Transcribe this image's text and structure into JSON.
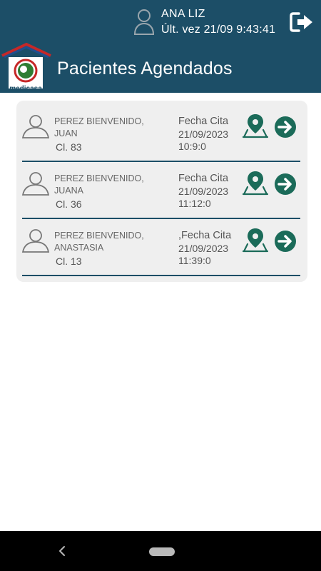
{
  "user": {
    "name": "ANA LIZ",
    "last_access": "Últ. vez 21/09 9:43:41"
  },
  "header": {
    "title": "Pacientes Agendados"
  },
  "logo": {
    "text": "medicasa"
  },
  "colors": {
    "header_bg": "#1c4e67",
    "accent": "#1b6b59",
    "card_bg": "#efefef"
  },
  "patients": [
    {
      "name_line1": "PEREZ BIENVENIDO,",
      "name_line2": "JUAN",
      "cl": "Cl. 83",
      "label": "Fecha Cita",
      "date": "21/09/2023",
      "time": "10:9:0"
    },
    {
      "name_line1": "PEREZ BIENVENIDO,",
      "name_line2": "JUANA",
      "cl": "Cl. 36",
      "label": "Fecha Cita",
      "date": "21/09/2023",
      "time": "11:12:0"
    },
    {
      "name_line1": "PEREZ BIENVENIDO,",
      "name_line2": "ANASTASIA",
      "cl": "Cl. 13",
      "label": ",Fecha Cita",
      "date": "21/09/2023",
      "time": "11:39:0"
    }
  ],
  "icons": [
    "user-icon",
    "logout-icon",
    "person-icon",
    "map-pin-icon",
    "arrow-right-icon",
    "back-icon"
  ]
}
